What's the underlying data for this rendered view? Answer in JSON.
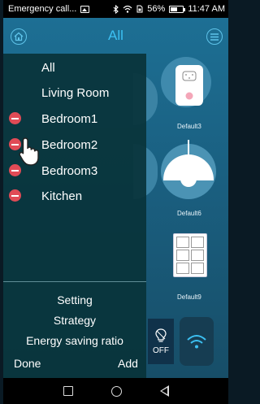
{
  "status_bar": {
    "notification_text": "Emergency call...",
    "battery": "56%",
    "battery_level": 0.56,
    "time": "11:47 AM",
    "icons": [
      "image-icon",
      "bluetooth-icon",
      "wifi-icon",
      "sim-icon",
      "battery-icon"
    ]
  },
  "header": {
    "title": "All",
    "left_icon": "home-icon",
    "right_icon": "menu-icon"
  },
  "devices": [
    {
      "label": "Default3",
      "icon": "smart-plug-icon"
    },
    {
      "label": "Default6",
      "icon": "pendant-lamp-icon"
    },
    {
      "label": "Default9",
      "icon": "switch-panel-icon"
    }
  ],
  "controls": {
    "off_label": "OFF",
    "off_icon": "bulb-icon",
    "wifi_icon": "wifi-icon"
  },
  "drawer": {
    "rooms": [
      {
        "label": "All",
        "removable": false
      },
      {
        "label": "Living Room",
        "removable": false
      },
      {
        "label": "Bedroom1",
        "removable": true
      },
      {
        "label": "Bedroom2",
        "removable": true
      },
      {
        "label": "Bedroom3",
        "removable": true
      },
      {
        "label": "Kitchen",
        "removable": true
      }
    ],
    "bottom_items": [
      "Setting",
      "Strategy",
      "Energy saving ratio"
    ],
    "done_label": "Done",
    "add_label": "Add"
  },
  "colors": {
    "accent": "#3cc0f2",
    "delete": "#e04b56",
    "drawer_bg": "#09343a"
  }
}
